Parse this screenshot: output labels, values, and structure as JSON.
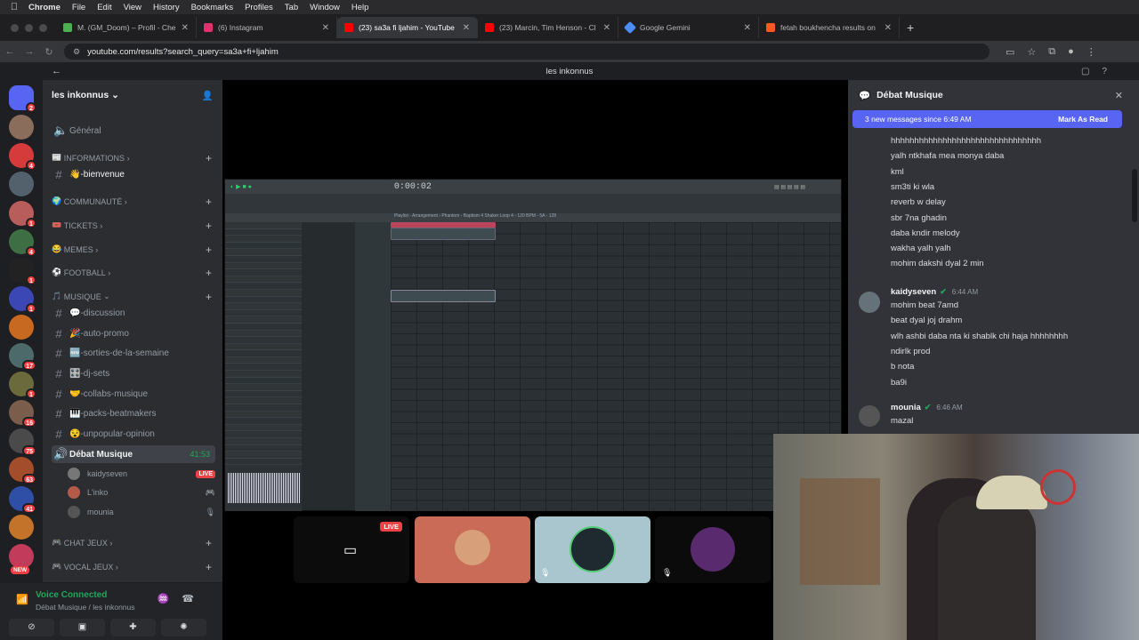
{
  "menubar": {
    "apple": "",
    "items": [
      "Chrome",
      "File",
      "Edit",
      "View",
      "History",
      "Bookmarks",
      "Profiles",
      "Tab",
      "Window",
      "Help"
    ]
  },
  "tabs": [
    {
      "title": "M. (GM_Doom) – Profil - Che",
      "color": "#4caf50"
    },
    {
      "title": "(6) Instagram",
      "color": "#e1306c"
    },
    {
      "title": "(23) sa3a fi ljahim - YouTube",
      "color": "#ff0000"
    },
    {
      "title": "(23) Marcin, Tim Henson - Cl",
      "color": "#ff0000"
    },
    {
      "title": "Google Gemini",
      "color": "#4b8df8"
    },
    {
      "title": "fetah boukhencha results on",
      "color": "#ff5722"
    }
  ],
  "url": "youtube.com/results?search_query=sa3a+fi+ljahim",
  "discord_title": "les inkonnus",
  "servers": [
    {
      "badge": "2",
      "color": "#5865f2"
    },
    {
      "badge": "",
      "color": "#8a6d5a"
    },
    {
      "badge": "4",
      "color": "#d63b3b"
    },
    {
      "badge": "",
      "color": "#52616b"
    },
    {
      "badge": "1",
      "color": "#b85c5c"
    },
    {
      "badge": "4",
      "color": "#3d6e44"
    },
    {
      "badge": "1",
      "color": "#222"
    },
    {
      "badge": "1",
      "color": "#3b47b5"
    },
    {
      "badge": "",
      "color": "#c76a1f"
    },
    {
      "badge": "17",
      "color": "#4c6a6a"
    },
    {
      "badge": "1",
      "color": "#6a6a3d"
    },
    {
      "badge": "16",
      "color": "#7a5d4a"
    },
    {
      "badge": "75",
      "color": "#4a4a4a"
    },
    {
      "badge": "63",
      "color": "#a34d2a"
    },
    {
      "badge": "41",
      "color": "#2f4fa6"
    },
    {
      "badge": "",
      "color": "#c4732a"
    },
    {
      "badge": "",
      "color": "#c23b5a"
    }
  ],
  "new_label": "NEW",
  "server_name": "les inkonnus",
  "sidebar": {
    "general": "Général",
    "cat_informations": "INFORMATIONS",
    "bienvenue": "👋-bienvenue",
    "cat_communaute": "COMMUNAUTÉ",
    "cat_tickets": "TICKETS",
    "cat_memes": "MEMES",
    "cat_football": "FOOTBALL",
    "cat_musique": "MUSIQUE",
    "discussion": "💬-discussion",
    "auto_promo": "🎉-auto-promo",
    "sorties": "🆕-sorties-de-la-semaine",
    "djsets": "🎛️-dj-sets",
    "collabs": "🤝-collabs-musique",
    "packs": "🎹-packs-beatmakers",
    "unpopular": "😵-unpopular-opinion",
    "debat": "Débat Musique",
    "debat_time": "41:53",
    "users": [
      {
        "name": "kaidyseven",
        "live": "LIVE"
      },
      {
        "name": "L'inko"
      },
      {
        "name": "mounia"
      }
    ],
    "cat_chat_jeux": "CHAT JEUX",
    "cat_vocal_jeux": "VOCAL JEUX"
  },
  "voice": {
    "status": "Voice Connected",
    "sub": "Débat Musique / les inkonnus"
  },
  "fl": {
    "time": "0:00:02",
    "playlist": "Playlist - Arrangement › Phantom - Baptism 4 Shaker Loop 4 - 120 BPM - 5A - 128"
  },
  "tiles": {
    "live": "LIVE"
  },
  "chat": {
    "title": "Débat Musique",
    "new_messages": "3 new messages since 6:49 AM",
    "mark_read": "Mark As Read",
    "lines1": [
      "hhhhhhhhhhhhhhhhhhhhhhhhhhhhhhhh",
      "yalh ntkhafa mea monya daba",
      "kml",
      "sm3ti ki wla",
      "reverb w delay",
      "sbr 7na ghadin",
      "daba kndir melody",
      "wakha yalh yalh",
      "mohim dakshi dyal 2 min"
    ],
    "author2": "kaidyseven",
    "time2": "6:44 AM",
    "lines2": [
      "mohim beat 7amd",
      "beat dyal joj drahm",
      "wlh ashbi daba nta ki shablk chi haja hhhhhhhh",
      "ndirlk prod",
      "b nota",
      "ba9i"
    ],
    "author3": "mounia",
    "time3": "6:46 AM",
    "lines3": [
      "mazal"
    ]
  }
}
